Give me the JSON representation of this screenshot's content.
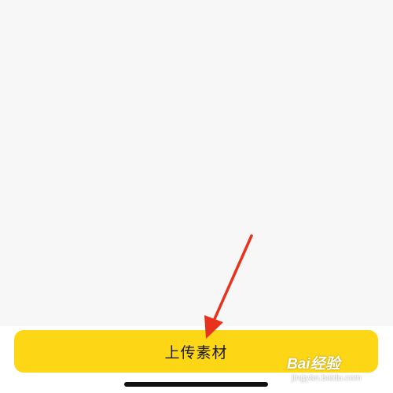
{
  "upload_button": {
    "label": "上传素材",
    "color": "#fdd616"
  },
  "watermark": {
    "brand": "Bai经验",
    "url": "jingyan.baidu.com"
  },
  "annotation": {
    "icon": "red-arrow-icon",
    "color": "#e8321e"
  }
}
